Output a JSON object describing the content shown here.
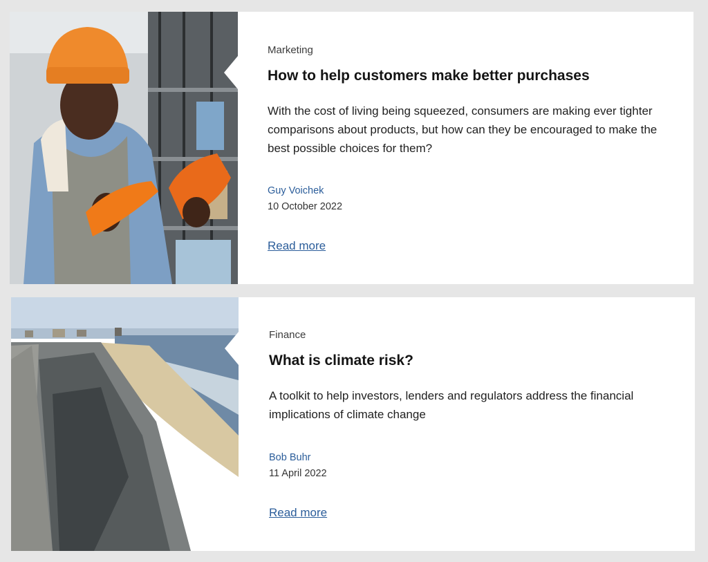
{
  "articles": [
    {
      "category": "Marketing",
      "title": "How to help customers make better purchases",
      "summary": "With the cost of living being squeezed, consumers are making ever tighter comparisons about products, but how can they be encouraged to make the best possible choices for them?",
      "author": "Guy Voichek",
      "date": "10 October 2022",
      "read_more": "Read more"
    },
    {
      "category": "Finance",
      "title": "What is climate risk?",
      "summary": "A toolkit to help investors, lenders and regulators address the financial implications of climate change",
      "author": "Bob Buhr",
      "date": "11 April 2022",
      "read_more": "Read more"
    }
  ],
  "colors": {
    "link": "#2b5d9a",
    "background": "#e6e6e6",
    "card": "#ffffff"
  }
}
